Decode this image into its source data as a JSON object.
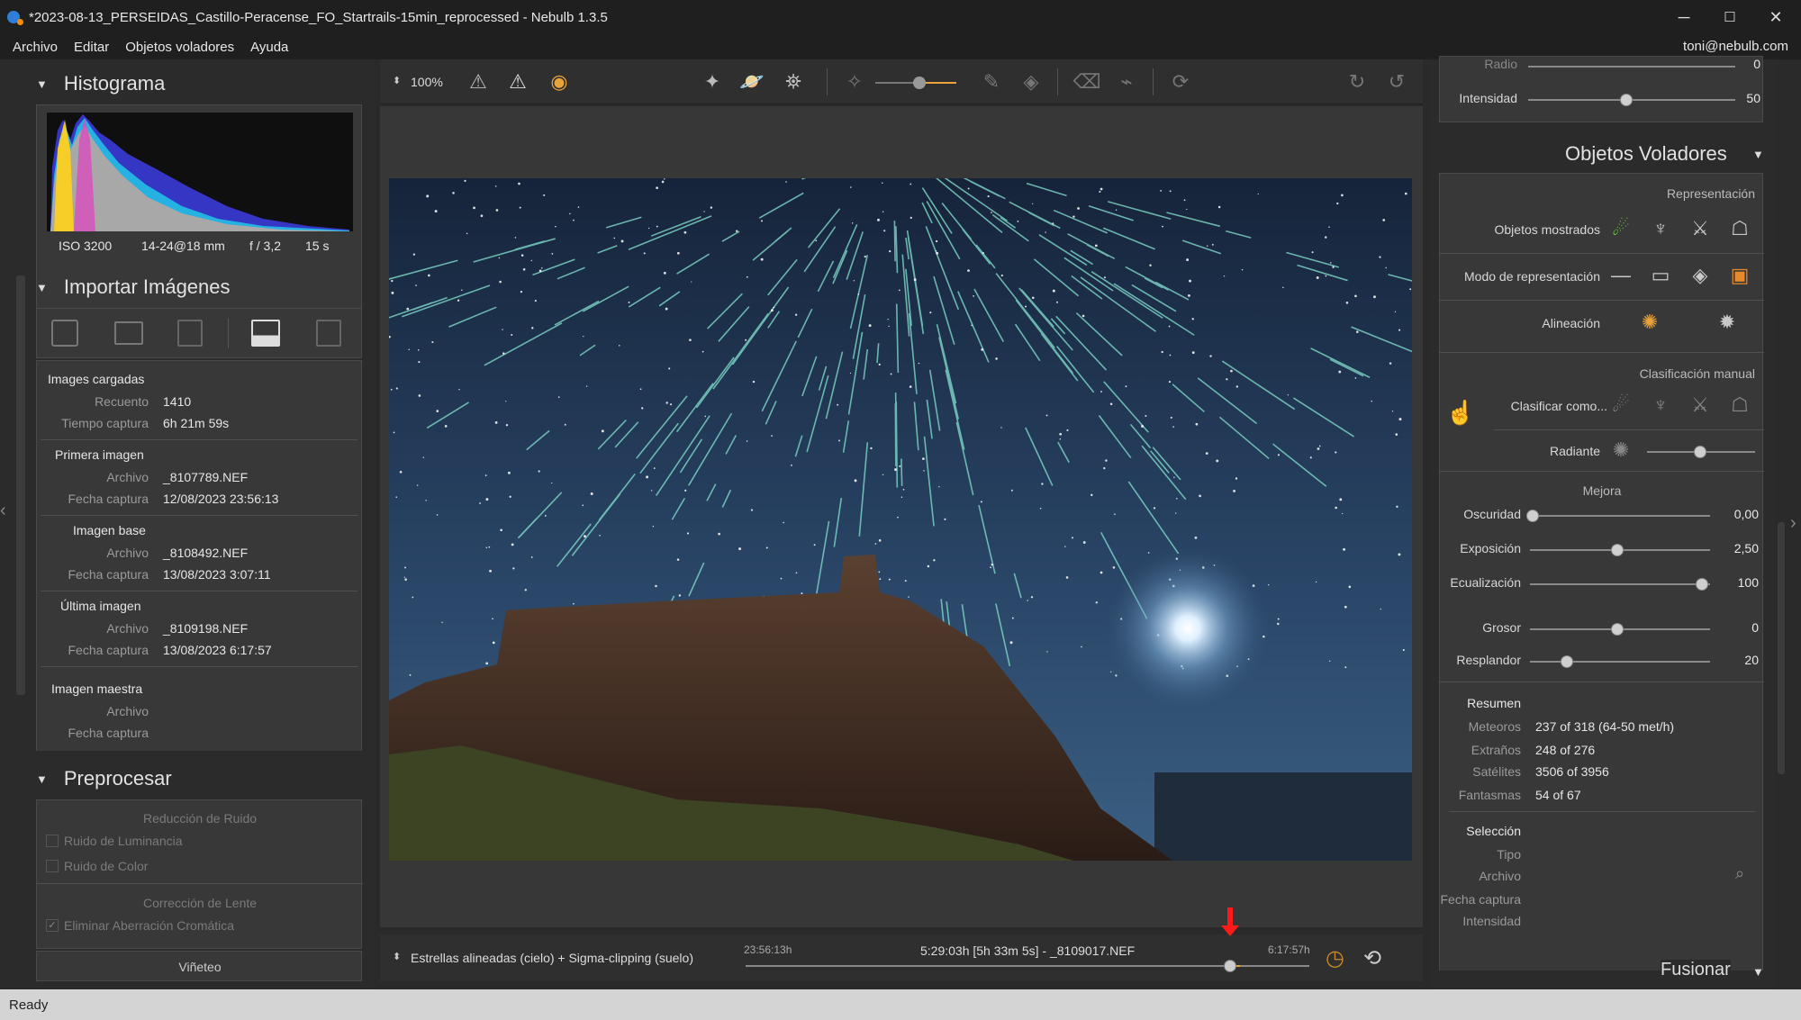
{
  "window": {
    "title": "*2023-08-13_PERSEIDAS_Castillo-Peracense_FO_Startrails-15min_reprocessed - Nebulb 1.3.5",
    "minimize": "─",
    "maximize": "☐",
    "close": "✕"
  },
  "menu": {
    "items": [
      "Archivo",
      "Editar",
      "Objetos voladores",
      "Ayuda"
    ],
    "user": "toni@nebulb.com"
  },
  "histogram": {
    "title": "Histograma",
    "iso": "ISO 3200",
    "lens": "14-24@18 mm",
    "aperture": "f / 3,2",
    "exposure": "15 s"
  },
  "import": {
    "title": "Importar Imágenes",
    "loaded": {
      "heading": "Images cargadas",
      "count_label": "Recuento",
      "count": "1410",
      "time_label": "Tiempo captura",
      "time": "6h 21m 59s"
    },
    "first": {
      "heading": "Primera imagen",
      "file_label": "Archivo",
      "file": "_8107789.NEF",
      "date_label": "Fecha captura",
      "date": "12/08/2023 23:56:13"
    },
    "base": {
      "heading": "Imagen base",
      "file_label": "Archivo",
      "file": "_8108492.NEF",
      "date_label": "Fecha captura",
      "date": "13/08/2023 3:07:11"
    },
    "last": {
      "heading": "Última imagen",
      "file_label": "Archivo",
      "file": "_8109198.NEF",
      "date_label": "Fecha captura",
      "date": "13/08/2023 6:17:57"
    },
    "master": {
      "heading": "Imagen maestra",
      "file_label": "Archivo",
      "date_label": "Fecha captura"
    }
  },
  "preprocess": {
    "title": "Preprocesar",
    "noise_heading": "Reducción de Ruido",
    "luminance": "Ruido de Luminancia",
    "color": "Ruido de Color",
    "lens_heading": "Corrección de Lente",
    "chromatic": "Eliminar Aberración Cromática",
    "vignette": "Viñeteo"
  },
  "toolbar": {
    "zoom": "100%"
  },
  "bottom": {
    "mode": "Estrellas alineadas (cielo) + Sigma-clipping (suelo)",
    "start": "23:56:13h",
    "current": "5:29:03h [5h 33m 5s] - _8109017.NEF",
    "end": "6:17:57h",
    "position": 0.86
  },
  "right": {
    "top": {
      "radio_label": "Radio",
      "radio_val": "0",
      "intensidad_label": "Intensidad",
      "intensidad_val": "50"
    },
    "title": "Objetos Voladores",
    "representacion": "Representación",
    "objetos_mostrados": "Objetos mostrados",
    "modo": "Modo de representación",
    "alineacion": "Alineación",
    "clasif_manual": "Clasificación manual",
    "clasificar": "Clasificar como...",
    "radiante": "Radiante",
    "mejora": "Mejora",
    "oscuridad": {
      "label": "Oscuridad",
      "value": "0,00"
    },
    "exposicion": {
      "label": "Exposición",
      "value": "2,50"
    },
    "ecualizacion": {
      "label": "Ecualización",
      "value": "100"
    },
    "grosor": {
      "label": "Grosor",
      "value": "0"
    },
    "resplandor": {
      "label": "Resplandor",
      "value": "20"
    },
    "resumen": "Resumen",
    "meteoros": {
      "label": "Meteoros",
      "value": "237 of 318 (64-50 met/h)"
    },
    "extranos": {
      "label": "Extraños",
      "value": "248 of 276"
    },
    "satelites": {
      "label": "Satélites",
      "value": "3506 of 3956"
    },
    "fantasmas": {
      "label": "Fantasmas",
      "value": "54 of 67"
    },
    "seleccion": "Selección",
    "tipo": "Tipo",
    "archivo": "Archivo",
    "fecha": "Fecha captura",
    "intensidad": "Intensidad",
    "fusionar": "Fusionar"
  },
  "status": "Ready",
  "colors": {
    "accent": "#e8a33a",
    "active_icon": "#e88a2a",
    "green": "#6fcf3a",
    "arrow": "#ff1a1a"
  }
}
